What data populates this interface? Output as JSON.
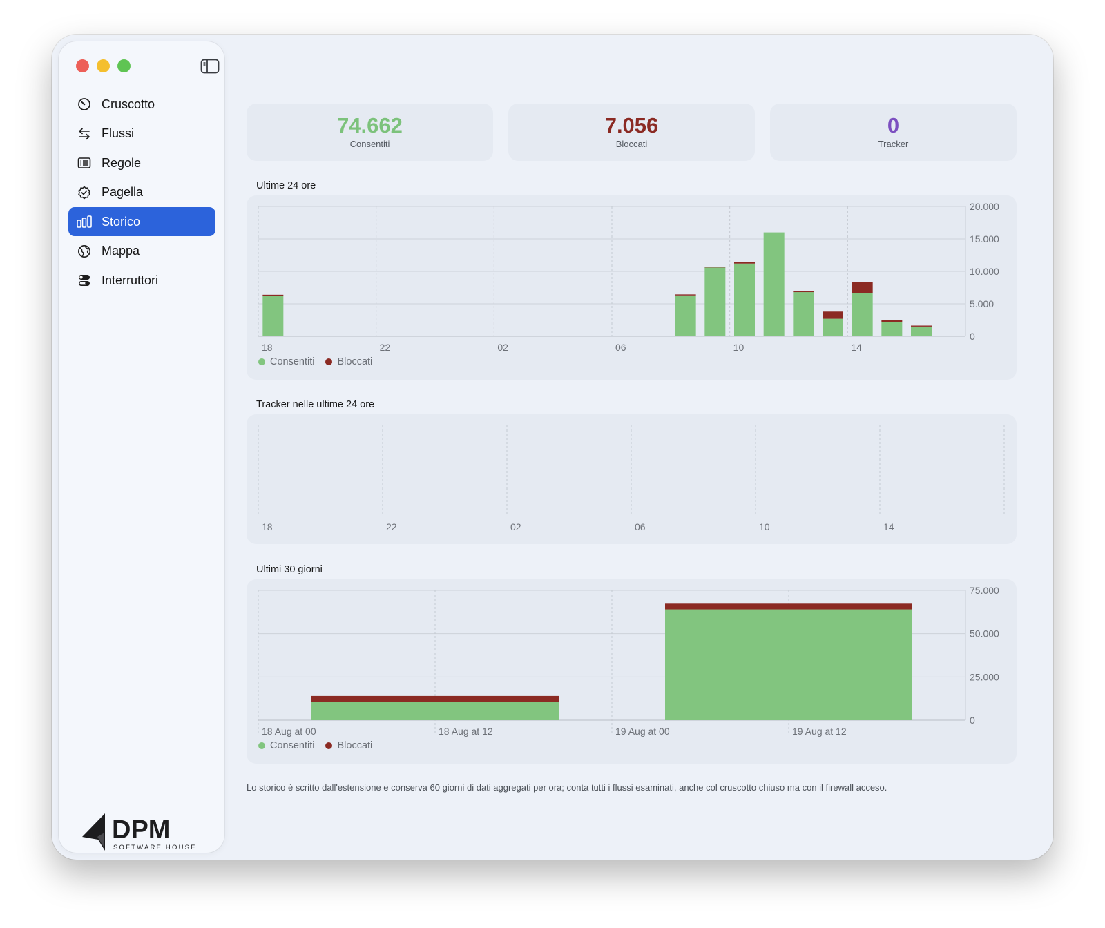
{
  "window": {
    "traffic_lights": {
      "close": "#ed5f58",
      "minimize": "#f4bf2e",
      "zoom": "#5fc453"
    },
    "sidebar_toggle_icon": "sidebar-toggle-icon"
  },
  "sidebar": {
    "items": [
      {
        "label": "Cruscotto",
        "icon": "gauge-icon",
        "active": false
      },
      {
        "label": "Flussi",
        "icon": "arrows-left-right-icon",
        "active": false
      },
      {
        "label": "Regole",
        "icon": "list-icon",
        "active": false
      },
      {
        "label": "Pagella",
        "icon": "badge-check-icon",
        "active": false
      },
      {
        "label": "Storico",
        "icon": "bar-chart-icon",
        "active": true
      },
      {
        "label": "Mappa",
        "icon": "globe-icon",
        "active": false
      },
      {
        "label": "Interruttori",
        "icon": "switches-icon",
        "active": false
      }
    ],
    "logo": {
      "name": "DPM",
      "tagline": "SOFTWARE HOUSE"
    }
  },
  "stats": [
    {
      "value": "74.662",
      "label": "Consentiti",
      "color": "#7cc27b"
    },
    {
      "value": "7.056",
      "label": "Bloccati",
      "color": "#8b2a23"
    },
    {
      "value": "0",
      "label": "Tracker",
      "color": "#7c4fc0"
    }
  ],
  "colors": {
    "allowed": "#82c57f",
    "blocked": "#8b2a23",
    "accent": "#2c63db"
  },
  "sections": {
    "last24": "Ultime 24 ore",
    "trackers24": "Tracker nelle ultime 24 ore",
    "last30": "Ultimi 30 giorni"
  },
  "legend": {
    "allowed": "Consentiti",
    "blocked": "Bloccati"
  },
  "footnote": "Lo storico è scritto dall'estensione e conserva 60 giorni di dati aggregati per ora; conta tutti i flussi esaminati, anche col cruscotto chiuso ma con il firewall acceso.",
  "chart_data": [
    {
      "type": "bar",
      "title": "Ultime 24 ore",
      "stacked": true,
      "x_ticks": [
        "18",
        "22",
        "02",
        "06",
        "10",
        "14"
      ],
      "categories": [
        "18",
        "19",
        "20",
        "21",
        "22",
        "23",
        "00",
        "01",
        "02",
        "03",
        "04",
        "05",
        "06",
        "07",
        "08",
        "09",
        "10",
        "11",
        "12",
        "13",
        "14",
        "15",
        "16",
        "17"
      ],
      "series": [
        {
          "name": "Consentiti",
          "color": "#82c57f",
          "values": [
            6200,
            0,
            0,
            0,
            0,
            0,
            0,
            0,
            0,
            0,
            0,
            0,
            0,
            0,
            6300,
            10600,
            11200,
            16000,
            6800,
            2700,
            6700,
            2200,
            1500,
            100
          ]
        },
        {
          "name": "Bloccati",
          "color": "#8b2a23",
          "values": [
            200,
            0,
            0,
            0,
            0,
            0,
            0,
            0,
            0,
            0,
            0,
            0,
            0,
            0,
            150,
            100,
            200,
            0,
            200,
            1100,
            1600,
            300,
            150,
            0
          ]
        }
      ],
      "y_ticks": [
        "20.000",
        "15.000",
        "10.000",
        "5.000",
        "0"
      ],
      "ylim": [
        0,
        20000
      ],
      "legend": "bottom-left",
      "grid": true
    },
    {
      "type": "bar",
      "title": "Tracker nelle ultime 24 ore",
      "x_ticks": [
        "18",
        "22",
        "02",
        "06",
        "10",
        "14"
      ],
      "series": [],
      "grid": true
    },
    {
      "type": "bar",
      "title": "Ultimi 30 giorni",
      "stacked": true,
      "x_ticks": [
        "18 Aug at 00",
        "18 Aug at 12",
        "19 Aug at 00",
        "19 Aug at 12"
      ],
      "categories": [
        "18 Aug",
        "19 Aug"
      ],
      "series": [
        {
          "name": "Consentiti",
          "color": "#82c57f",
          "values": [
            10500,
            64000
          ]
        },
        {
          "name": "Bloccati",
          "color": "#8b2a23",
          "values": [
            3500,
            3300
          ]
        }
      ],
      "y_ticks": [
        "75.000",
        "50.000",
        "25.000",
        "0"
      ],
      "ylim": [
        0,
        75000
      ],
      "legend": "bottom-left",
      "grid": true
    }
  ]
}
